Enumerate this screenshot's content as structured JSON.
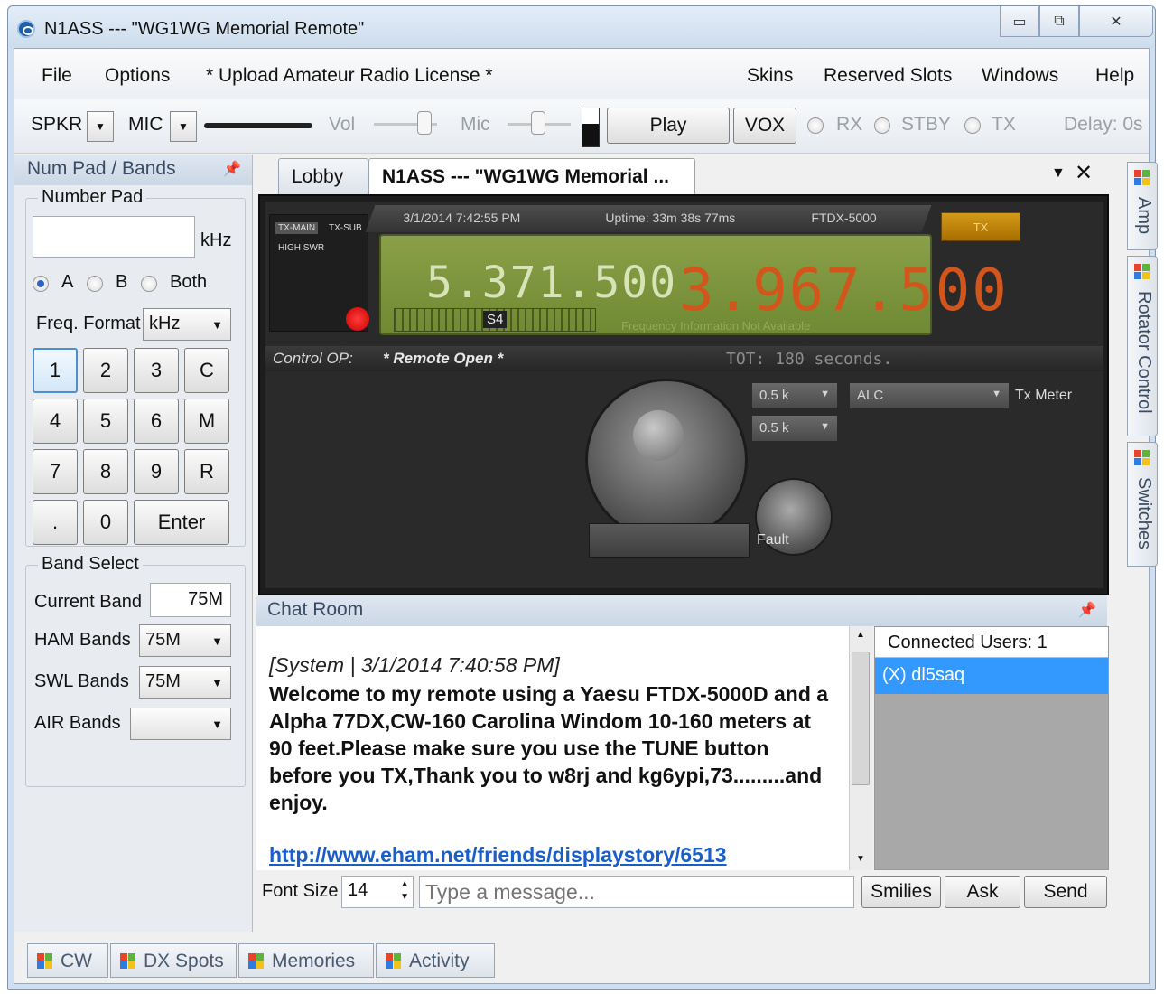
{
  "window": {
    "title": "N1ASS --- \"WG1WG Memorial Remote\"",
    "controls": [
      "▭",
      "⧉",
      "✕"
    ]
  },
  "menu": {
    "file": "File",
    "options": "Options",
    "upload": "* Upload Amateur Radio License *",
    "skins": "Skins",
    "reserved_slots": "Reserved Slots",
    "windows": "Windows",
    "help": "Help"
  },
  "toolbar": {
    "spkr": "SPKR",
    "mic": "MIC",
    "vol": "Vol",
    "mic_slider": "Mic",
    "play": "Play",
    "vox": "VOX",
    "rx": "RX",
    "stby": "STBY",
    "tx": "TX",
    "delay": "Delay: 0s"
  },
  "left_panel": {
    "title": "Num Pad / Bands",
    "number_pad_label": "Number Pad",
    "unit": "kHz",
    "vfo_options": [
      "A",
      "B",
      "Both"
    ],
    "vfo_selected": "A",
    "freq_format_label": "Freq. Format",
    "freq_format_value": "kHz",
    "keys": [
      "1",
      "2",
      "3",
      "C",
      "4",
      "5",
      "6",
      "M",
      "7",
      "8",
      "9",
      "R",
      ".",
      "0",
      "Enter"
    ],
    "band_select_label": "Band Select",
    "current_band_label": "Current Band",
    "current_band_value": "75M",
    "ham_bands_label": "HAM Bands",
    "ham_bands_value": "75M",
    "swl_bands_label": "SWL Bands",
    "swl_bands_value": "75M",
    "air_bands_label": "AIR Bands",
    "air_bands_value": ""
  },
  "tabs": {
    "lobby": "Lobby",
    "active": "N1ASS --- \"WG1WG Memorial ..."
  },
  "radio": {
    "tx_main": "TX-MAIN",
    "tx_sub": "TX-SUB",
    "high_swr": "HIGH SWR",
    "datetime": "3/1/2014 7:42:55 PM",
    "uptime": "Uptime: 33m 38s 77ms",
    "model": "FTDX-5000",
    "tx_indicator": "TX",
    "freq_sub": "5.371.500",
    "freq_main": "3.967.500",
    "s_meter": "S4",
    "freq_info": "Frequency Information Not Available",
    "control_op_label": "Control OP:",
    "control_op_value": "* Remote Open *",
    "tot": "TOT: 180 seconds.",
    "filter1": "0.5 k",
    "filter2": "0.5 k",
    "meter_select": "ALC",
    "tx_meter_label": "Tx Meter",
    "fault_label": "Fault"
  },
  "chat": {
    "title": "Chat Room",
    "system_line": "[System | 3/1/2014 7:40:58 PM]",
    "message": "Welcome to my remote using a Yaesu FTDX-5000D and a Alpha 77DX,CW-160 Carolina Windom 10-160 meters at 90 feet.Please make sure you use the TUNE button before you TX,Thank you to w8rj and kg6ypi,73.........and enjoy.",
    "link": "http://www.eham.net/friends/displaystory/6513",
    "connected_users": "Connected Users: 1",
    "users": [
      "(X) dl5saq"
    ],
    "font_size_label": "Font Size",
    "font_size_value": "14",
    "input_placeholder": "Type a message...",
    "smilies": "Smilies",
    "ask": "Ask",
    "send": "Send"
  },
  "side_tabs": [
    "Amp",
    "Rotator Control",
    "Switches"
  ],
  "bottom_tabs": [
    "CW",
    "DX Spots",
    "Memories",
    "Activity"
  ]
}
